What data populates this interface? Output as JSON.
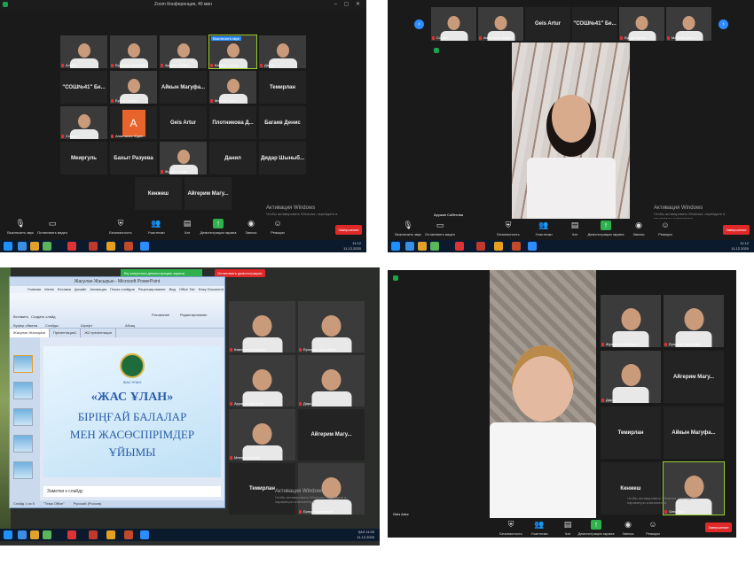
{
  "zoom_title": "Zoom Конференция, 40 мин",
  "shot1": {
    "tiles": [
      {
        "label": "",
        "caption": "Алиан",
        "video": true
      },
      {
        "label": "",
        "caption": "Ерзожан Орынбаев",
        "video": true
      },
      {
        "label": "",
        "caption": "Аружан Сабет...",
        "video": true
      },
      {
        "label": "",
        "caption": "Камила Султа...",
        "video": true,
        "active": true,
        "badge": "Выключить звук"
      },
      {
        "label": "",
        "caption": "Дарья",
        "video": true
      },
      {
        "label": "\"СОШ№41\" Бе...",
        "caption": "",
        "video": false
      },
      {
        "label": "",
        "caption": "Ернур Мухан...",
        "video": true
      },
      {
        "label": "Айкын Магуфа...",
        "caption": "",
        "video": false
      },
      {
        "label": "",
        "caption": "Матвей Гринч...",
        "video": true
      },
      {
        "label": "Темирлан",
        "caption": "",
        "video": false
      },
      {
        "label": "",
        "caption": "Софья",
        "video": true
      },
      {
        "label": "А",
        "caption": "Анастасия Юдин...",
        "video": false,
        "avatar": true
      },
      {
        "label": "Geis Artur",
        "caption": "",
        "video": false
      },
      {
        "label": "Плотникова Д...",
        "caption": "",
        "video": false
      },
      {
        "label": "Багаев Денис",
        "caption": "",
        "video": false
      },
      {
        "label": "Меиргуль",
        "caption": "",
        "video": false
      },
      {
        "label": "Бахыт Разуева",
        "caption": "",
        "video": false
      },
      {
        "label": "",
        "caption": "Жулдыз Имм...",
        "video": true
      },
      {
        "label": "Данил",
        "caption": "",
        "video": false
      },
      {
        "label": "Дидар Шыныб...",
        "caption": "",
        "video": false
      },
      {
        "label": "Кенжеш",
        "caption": "",
        "video": false
      },
      {
        "label": "Айгерим Магу...",
        "caption": "",
        "video": false
      }
    ]
  },
  "shot2": {
    "strip": [
      {
        "label": "",
        "caption": "Софья",
        "video": true
      },
      {
        "label": "",
        "caption": "Анастасия Юдин...",
        "video": true
      },
      {
        "label": "Geis Artur",
        "caption": "",
        "video": false
      },
      {
        "label": "\"СОШ№41\" Бе...",
        "caption": "",
        "video": false
      },
      {
        "label": "",
        "caption": "Ернур Мухан...",
        "video": true
      },
      {
        "label": "",
        "caption": "Матвей Гринч...",
        "video": true
      }
    ],
    "speaker_caption": "Аружан Сабетова"
  },
  "shot3": {
    "ppt_title": "Жасулан Жасырын - Microsoft PowerPoint",
    "share_notice": "Вы запустили демонстрацию экрана",
    "stop_share": "Остановить демонстрацию",
    "ppt_menu": [
      "Главная",
      "Меню",
      "Вставка",
      "Дизайн",
      "Анимация",
      "Показ слайдов",
      "Рецензирование",
      "Вид",
      "Office Tab",
      "Easy Document Cr"
    ],
    "ribbon_labels": [
      "Вставить",
      "Создать слайд",
      "Буфер обмена",
      "Слайды",
      "Шрифт",
      "Абзац",
      "Рисование",
      "Редактирование"
    ],
    "doc_tabs": [
      "Жасулан Жасырын",
      "Презентация1",
      "Ж2 презентация"
    ],
    "slide_emblem": "ЖАС ҰЛАН",
    "slide_line1": "«ЖАС ҰЛАН»",
    "slide_line2": "БІРІҢҒАЙ БАЛАЛАР",
    "slide_line3": "МЕН ЖАСӨСПІРІМДЕР",
    "slide_line4": "ҰЙЫМЫ",
    "notes": "Заметки к слайду",
    "status": [
      "Слайд 1 из 5",
      "\"Тема Office\"",
      "Русский (Россия)"
    ],
    "side_tiles": [
      {
        "label": "",
        "caption": "Камила Султанова",
        "video": true
      },
      {
        "label": "",
        "caption": "Ерзожан Орынбаев",
        "video": true
      },
      {
        "label": "",
        "caption": "Аружан Сабетова",
        "video": true
      },
      {
        "label": "",
        "caption": "Дарья",
        "video": true
      },
      {
        "label": "",
        "caption": "Матвей Гринчук",
        "video": true
      },
      {
        "label": "Айгерим Магу...",
        "caption": "",
        "video": false
      },
      {
        "label": "Темирлан",
        "caption": "",
        "video": false
      },
      {
        "label": "",
        "caption": "Ернур Мухаметов",
        "video": true
      }
    ]
  },
  "shot4": {
    "tiles": [
      {
        "label": "",
        "caption": "Жулдыз Иммберген...",
        "video": true
      },
      {
        "label": "",
        "caption": "Ерзожан Орынбаев",
        "video": true
      },
      {
        "label": "",
        "caption": "Дарья",
        "video": true
      },
      {
        "label": "Айгерим Магу...",
        "caption": "",
        "video": false
      },
      {
        "label": "Темирлан",
        "caption": "",
        "video": false
      },
      {
        "label": "Айкын Магуфа...",
        "caption": "",
        "video": false
      },
      {
        "label": "Кенжеш",
        "caption": "",
        "video": false
      },
      {
        "label": "",
        "caption": "Geis Wlar",
        "video": true,
        "active": true
      }
    ],
    "speaker_caption": "Geis Artur"
  },
  "toolbar": {
    "mute": "Выключить звук",
    "video": "Остановить видео",
    "security": "Безопасность",
    "participants": "Участники",
    "participants_count": "22",
    "chat": "Чат",
    "share": "Демонстрация экрана",
    "record": "Запись",
    "reactions": "Реакции",
    "end": "Завершение"
  },
  "activation": {
    "title": "Активация Windows",
    "sub1": "Чтобы активировать Windows, перейдите в",
    "sub2": "параметры компьютера."
  },
  "taskbar": {
    "lang": "ҚАЗ",
    "time": "11:12",
    "time2": "11:00",
    "date": "11.12.2020"
  },
  "colors": {
    "zoom_bg": "#1a1a1a",
    "tile_bg": "#232323",
    "share_green": "#2fb14d",
    "end_red": "#e02828",
    "zoom_blue": "#2d8cff",
    "active_border": "#9acd32",
    "taskbar": "#0c1a2e"
  }
}
